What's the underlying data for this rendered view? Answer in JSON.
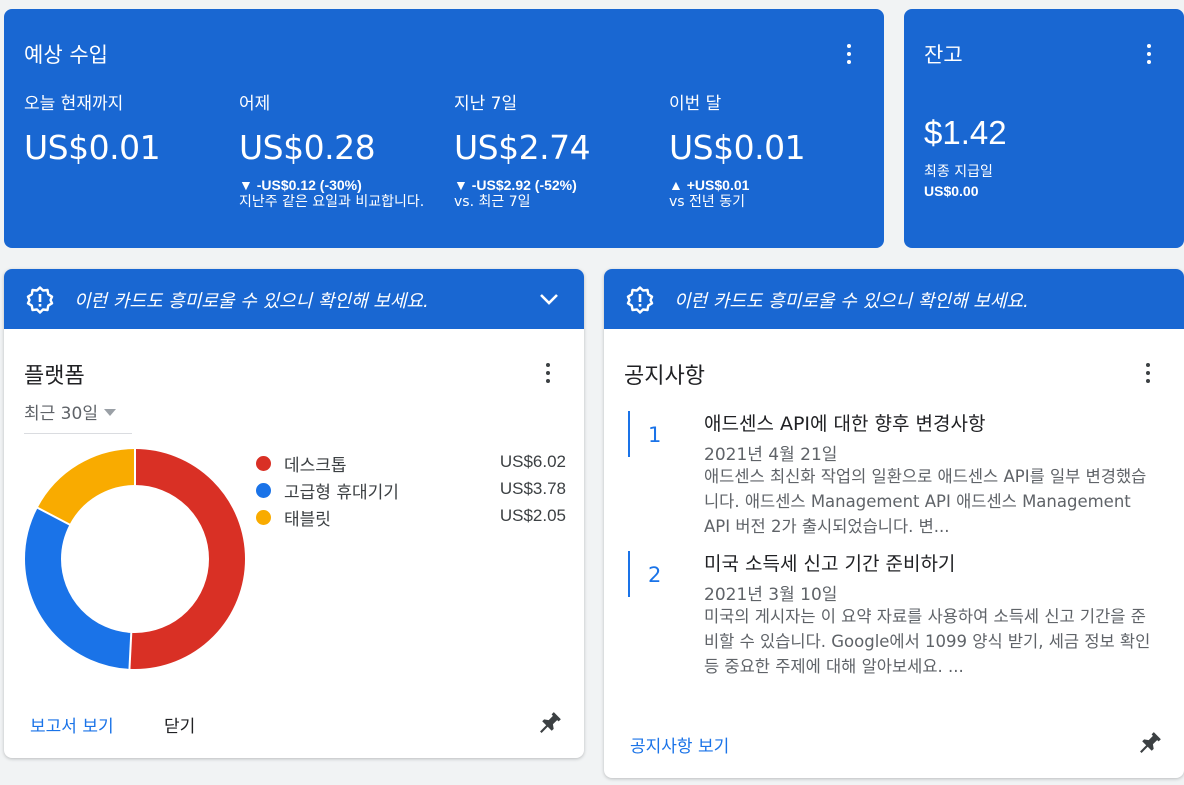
{
  "earnings": {
    "title": "예상 수입",
    "metrics": [
      {
        "label": "오늘 현재까지",
        "value": "US$0.01",
        "delta": "",
        "note": ""
      },
      {
        "label": "어제",
        "value": "US$0.28",
        "delta": "▼ -US$0.12 (-30%)",
        "note": "지난주 같은 요일과 비교합니다."
      },
      {
        "label": "지난 7일",
        "value": "US$2.74",
        "delta": "▼ -US$2.92 (-52%)",
        "note": "vs. 최근 7일"
      },
      {
        "label": "이번 달",
        "value": "US$0.01",
        "delta": "▲ +US$0.01",
        "note": "vs 전년 동기"
      }
    ]
  },
  "balance": {
    "title": "잔고",
    "value": "$1.42",
    "last_payment_label": "최종 지급일",
    "last_payment_value": "US$0.00"
  },
  "banner_text": "이런 카드도 흥미로울 수 있으니 확인해 보세요.",
  "platform": {
    "title": "플랫폼",
    "period": "최근 30일",
    "report_link": "보고서 보기",
    "close_label": "닫기"
  },
  "chart_data": {
    "type": "pie",
    "categories": [
      "데스크톱",
      "고급형 휴대기기",
      "태블릿"
    ],
    "values": [
      6.02,
      3.78,
      2.05
    ],
    "value_labels": [
      "US$6.02",
      "US$3.78",
      "US$2.05"
    ],
    "colors": [
      "#d93025",
      "#1a73e8",
      "#f9ab00"
    ],
    "donut": true,
    "legend": "right"
  },
  "notices": {
    "title": "공지사항",
    "items": [
      {
        "num": "1",
        "title": "애드센스 API에 대한 향후 변경사항",
        "date": "2021년 4월 21일",
        "body": "애드센스 최신화 작업의 일환으로 애드센스 API를 일부 변경했습니다. 애드센스 Management API 애드센스 Management API 버전 2가 출시되었습니다. 변..."
      },
      {
        "num": "2",
        "title": "미국 소득세 신고 기간 준비하기",
        "date": "2021년 3월 10일",
        "body": "미국의 게시자는 이 요약 자료를 사용하여 소득세 신고 기간을 준비할 수 있습니다. Google에서 1099 양식 받기, 세금 정보 확인 등 중요한 주제에 대해 알아보세요. ..."
      }
    ],
    "view_link": "공지사항 보기"
  },
  "colors": {
    "brand_blue": "#1967d2",
    "link_blue": "#1a73e8"
  }
}
